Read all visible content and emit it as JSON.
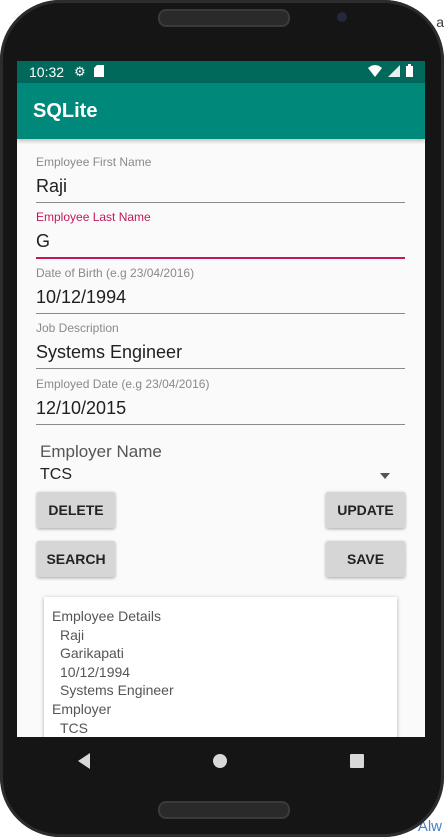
{
  "status": {
    "time": "10:32"
  },
  "app": {
    "title": "SQLite"
  },
  "form": {
    "first_name": {
      "label": "Employee First Name",
      "value": "Raji"
    },
    "last_name": {
      "label": "Employee Last Name",
      "value": "G"
    },
    "dob": {
      "label": "Date of Birth (e.g 23/04/2016)",
      "value": "10/12/1994"
    },
    "job": {
      "label": "Job Description",
      "value": "Systems Engineer"
    },
    "employed": {
      "label": "Employed Date (e.g 23/04/2016)",
      "value": "12/10/2015"
    },
    "employer": {
      "label": "Employer Name",
      "value": "TCS"
    }
  },
  "buttons": {
    "delete": "DELETE",
    "update": "UPDATE",
    "search": "SEARCH",
    "save": "SAVE"
  },
  "details": {
    "heading": "Employee Details",
    "lines": [
      "Raji",
      "Garikapati",
      "10/12/1994",
      "Systems Engineer"
    ],
    "employer_heading": "Employer",
    "employer_value": "TCS"
  },
  "background": {
    "edge_top": "a",
    "edge_link": "Alw"
  },
  "colors": {
    "status_bar": "#00695c",
    "app_bar": "#00897b",
    "focus_accent": "#c2185b"
  },
  "icons": [
    "gear-icon",
    "sd-card-icon",
    "wifi-icon",
    "signal-icon",
    "battery-icon",
    "back-icon",
    "home-icon",
    "recents-icon"
  ]
}
